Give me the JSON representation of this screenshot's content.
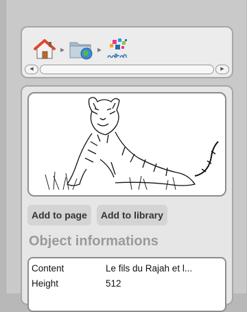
{
  "breadcrumb": {
    "icons": [
      "home-icon",
      "network-folder-icon",
      "datafolder-logo-icon"
    ],
    "separator": "▸"
  },
  "preview": {
    "alt": "tiger illustration"
  },
  "buttons": {
    "add_to_page": "Add to page",
    "add_to_library": "Add to library"
  },
  "section_title": "Object informations",
  "info": [
    {
      "key": "Content",
      "value": "Le fils du Rajah et l..."
    },
    {
      "key": "Height",
      "value": "512"
    }
  ],
  "colors": {
    "background": "#b8b8b8",
    "panel": "#e6e6e6",
    "title_gray": "#9a9a9a"
  }
}
